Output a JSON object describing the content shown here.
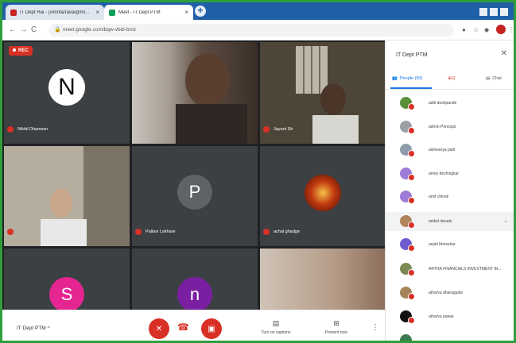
{
  "browser": {
    "tabs": [
      {
        "title": "IT Dept Hai - (Amrita/ravai@mi...",
        "color": "#c5221f"
      },
      {
        "title": "Meet - IT Dept PTM",
        "color": "#0f9d58"
      }
    ],
    "url": "meet.google.com/bqw-vbdi-bmz"
  },
  "meeting": {
    "rec_label": "REC",
    "title": "IT Dept PTM",
    "controls": {
      "captions": "Turn on captions",
      "present": "Present now"
    }
  },
  "tiles": [
    {
      "name": "Nikhil Dhanwan",
      "initial": "N"
    },
    {
      "name": "",
      "initial": ""
    },
    {
      "name": "Jayant Sh",
      "initial": ""
    },
    {
      "name": "",
      "initial": ""
    },
    {
      "name": "Pallavi Lokhare",
      "initial": "P"
    },
    {
      "name": "achal ghadge",
      "initial": ""
    },
    {
      "name": "",
      "initial": "S"
    },
    {
      "name": "",
      "initial": "n"
    },
    {
      "name": "",
      "initial": ""
    }
  ],
  "panel": {
    "title": "IT Dept PTM",
    "tabs": {
      "people": "People (50)",
      "chat": "Chat"
    },
    "participants": [
      {
        "name": "aditi deshpande",
        "color": "#5a8f3a"
      },
      {
        "name": "admin Principal",
        "color": "#9aa0a6"
      },
      {
        "name": "aishwarya patil",
        "color": "#8e9dab"
      },
      {
        "name": "amey deshingkar",
        "color": "#9e7bd6"
      },
      {
        "name": "amit chinali",
        "color": "#9e7bd6"
      },
      {
        "name": "aniket desale",
        "color": "#b0855c"
      },
      {
        "name": "anjali bhosekar",
        "color": "#6d5bd0"
      },
      {
        "name": "ARTHA FINANCIALS INVESTMENT IN...",
        "color": "#7b8a55"
      },
      {
        "name": "atharva dhanagude",
        "color": "#a6835b"
      },
      {
        "name": "atharva pawar",
        "color": "#111111"
      },
      {
        "name": "",
        "color": "#3d7a4f"
      }
    ]
  }
}
